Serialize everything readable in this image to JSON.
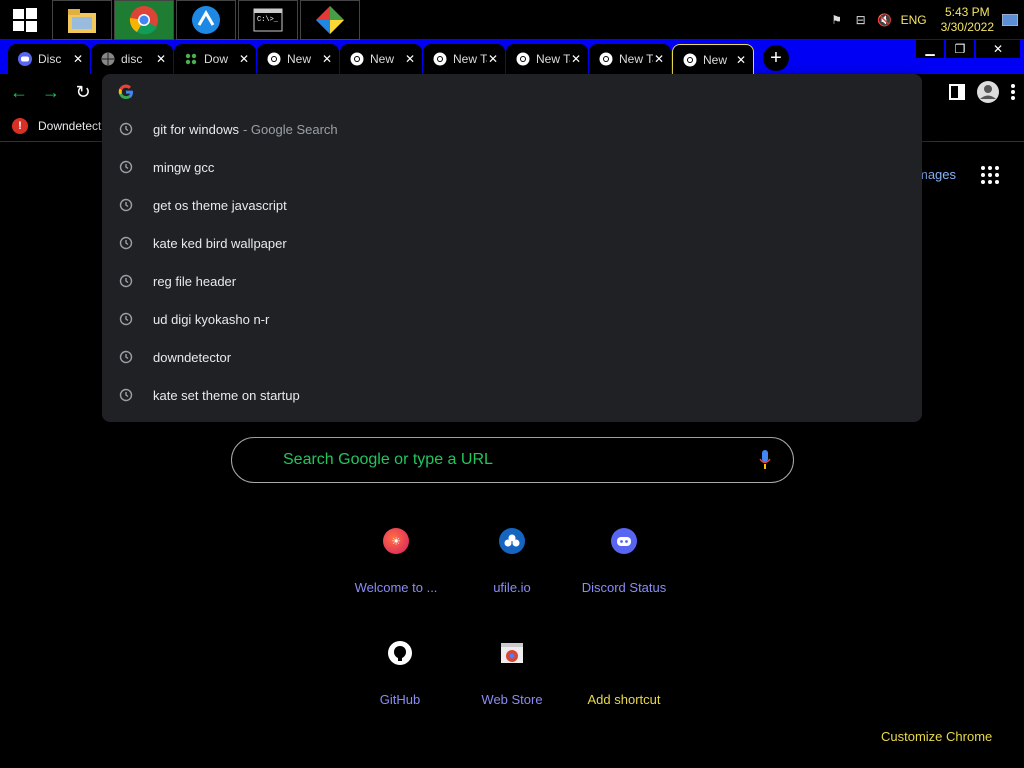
{
  "taskbar": {
    "buttons": [
      {
        "name": "windows-start-icon"
      },
      {
        "name": "file-explorer-icon"
      },
      {
        "name": "chrome-icon"
      },
      {
        "name": "app-icon-blue"
      },
      {
        "name": "command-prompt-icon"
      },
      {
        "name": "app-icon-diamond"
      }
    ],
    "tray": {
      "lang": "ENG",
      "time": "5:43 PM",
      "date": "3/30/2022"
    }
  },
  "tabs": [
    {
      "title": "Disc",
      "icon": "discord-icon"
    },
    {
      "title": "disc",
      "icon": "globe-icon"
    },
    {
      "title": "Dow",
      "icon": "downdetector-icon"
    },
    {
      "title": "New",
      "icon": "chrome-icon"
    },
    {
      "title": "New",
      "icon": "chrome-icon"
    },
    {
      "title": "New Tab",
      "icon": "chrome-icon"
    },
    {
      "title": "New Tab",
      "icon": "chrome-icon"
    },
    {
      "title": "New Tab",
      "icon": "chrome-icon"
    },
    {
      "title": "New",
      "icon": "chrome-icon",
      "active": true
    }
  ],
  "bookmarks": {
    "item": "Downdetect"
  },
  "omnibox": {
    "value": "",
    "suggestions": [
      {
        "text": "git for windows",
        "extra": " - Google Search"
      },
      {
        "text": "mingw gcc",
        "extra": ""
      },
      {
        "text": "get os theme javascript",
        "extra": ""
      },
      {
        "text": "kate ked bird wallpaper",
        "extra": ""
      },
      {
        "text": "reg file header",
        "extra": ""
      },
      {
        "text": "ud digi kyokasho n-r",
        "extra": ""
      },
      {
        "text": "downdetector",
        "extra": ""
      },
      {
        "text": "kate set theme on startup",
        "extra": ""
      }
    ]
  },
  "ntp": {
    "images_link": "mages",
    "search_placeholder": "Search Google or type a URL",
    "shortcuts": [
      {
        "label": "Welcome to ...",
        "icon": "welcome-icon"
      },
      {
        "label": "ufile.io",
        "icon": "ufile-icon"
      },
      {
        "label": "Discord Status",
        "icon": "discord-icon"
      },
      {
        "label": "GitHub",
        "icon": "github-icon"
      },
      {
        "label": "Web Store",
        "icon": "web-store-icon"
      },
      {
        "label": "Add shortcut",
        "icon": "add-icon"
      }
    ],
    "customize": "Customize Chrome"
  },
  "colors": {
    "tabstrip": "#0000f5",
    "accent_yellow": "#e8d84a",
    "link_purple": "#8b8cf5",
    "placeholder_green": "#22c55e"
  }
}
